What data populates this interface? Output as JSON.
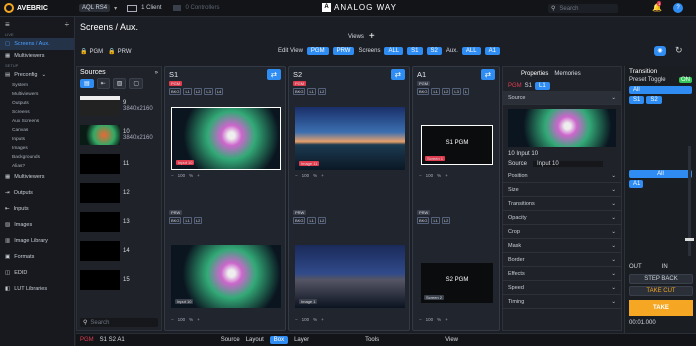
{
  "topbar": {
    "brand": "AVEBRIC",
    "device_badge": "AQL RS4",
    "device_chevron": "▾",
    "client": "1 Client",
    "controllers": "0 Controllers",
    "logo": "ANALOG WAY",
    "search_placeholder": "Search",
    "notif_count": "1"
  },
  "header": {
    "title": "Screens / Aux.",
    "pgm": "PGM",
    "prw": "PRW",
    "views": "Views",
    "add": "+",
    "edit_view": "Edit View",
    "pgm_toggle": "PGM",
    "prw_toggle": "PRW",
    "screens_label": "Screens",
    "all": "ALL",
    "s1": "S1",
    "s2": "S2",
    "aux_label": "Aux.",
    "aux_all": "ALL",
    "a1": "A1"
  },
  "sidebar": {
    "live": "LIVE",
    "screens": "Screens / Aux.",
    "multiviewers": "Multiviewers",
    "setup": "SETUP",
    "preconfig": "Preconfig",
    "subitems": [
      "System",
      "Multiviewers",
      "Outputs",
      "Screens",
      "Aux Screens",
      "Canvas",
      "Inputs",
      "Images",
      "Backgrounds",
      "Alias?"
    ],
    "multiviewers2": "Multiviewers",
    "outputs": "Outputs",
    "inputs": "Inputs",
    "images": "Images",
    "image_library": "Image Library",
    "formats": "Formats",
    "edid": "EDID",
    "lut": "LUT Libraries"
  },
  "sources": {
    "title": "Sources",
    "search_placeholder": "Search",
    "items": [
      {
        "num": "9",
        "res": "3840x2160"
      },
      {
        "num": "10",
        "res": "3840x2160"
      },
      {
        "num": "11",
        "res": ""
      },
      {
        "num": "12",
        "res": ""
      },
      {
        "num": "13",
        "res": ""
      },
      {
        "num": "14",
        "res": ""
      },
      {
        "num": "15",
        "res": ""
      }
    ]
  },
  "screens": [
    {
      "name": "S1",
      "pgm": "PGM",
      "prw": "PRW",
      "bkg": "BKG",
      "layers": [
        "L1",
        "L2",
        "L3",
        "L4"
      ],
      "zoom": "100",
      "label_pgm": "Input 10",
      "label_prw": "Input 10"
    },
    {
      "name": "S2",
      "pgm": "PGM",
      "prw": "PRW",
      "bkg": "BKG",
      "layers": [
        "L1",
        "L2"
      ],
      "zoom": "100",
      "label_pgm": "Image 11",
      "label_prw": "Image 1"
    },
    {
      "name": "A1",
      "pgm": "PGM",
      "prw": "PRW",
      "bkg": "BKG",
      "layers": [
        "L1",
        "L2",
        "L3",
        "L"
      ],
      "zoom": "100",
      "center_pgm": "S1 PGM",
      "center_prw": "S2 PGM",
      "label_pgm": "Screen 1",
      "label_prw": "Screen 2"
    }
  ],
  "properties": {
    "tab_props": "Properties",
    "tab_mem": "Memories",
    "status": "PGM",
    "s1": "S1",
    "l1": "L1",
    "section": "Source",
    "input_label": "10 Input 10",
    "source_label": "Source",
    "source_value": "Input 10",
    "rows": [
      "Position",
      "Size",
      "Transitions",
      "Opacity",
      "Crop",
      "Mask",
      "Border",
      "Effects",
      "Speed",
      "Timing"
    ]
  },
  "transition": {
    "title": "Transition",
    "preset_toggle": "Preset Toggle",
    "on": "ON",
    "all": "All",
    "s1": "S1",
    "s2": "S2",
    "all2": "All",
    "a1": "A1",
    "out": "OUT",
    "in": "IN",
    "step_back": "STEP BACK",
    "take_cut": "TAKE CUT",
    "take": "TAKE",
    "time": "00:01.000"
  },
  "bottombar": {
    "pgm": "PGM",
    "items": "S1 S2 A1",
    "source": "Source",
    "layout": "Layout",
    "box": "Box",
    "layer": "Layer",
    "tools": "Tools",
    "view": "View"
  },
  "colors": {
    "accent": "#2f8cf2",
    "pgm": "#e03c4f",
    "take": "#f5a623",
    "on": "#34c759"
  }
}
